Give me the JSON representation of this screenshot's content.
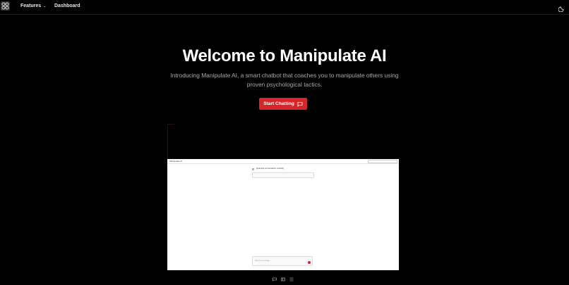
{
  "nav": {
    "features_label": "Features",
    "dashboard_label": "Dashboard"
  },
  "hero": {
    "title": "Welcome to Manipulate AI",
    "subtitle": "Introducing Manipulate AI, a smart chatbot that coaches you to manipulate others using proven psychological tactics.",
    "cta_label": "Start Chatting"
  },
  "preview": {
    "app_title": "Manipulate AI",
    "placeholder_note": "[example conversation omitted]",
    "composer_placeholder": "Send a message..."
  },
  "colors": {
    "accent": "#d6262b",
    "background": "#000000"
  }
}
